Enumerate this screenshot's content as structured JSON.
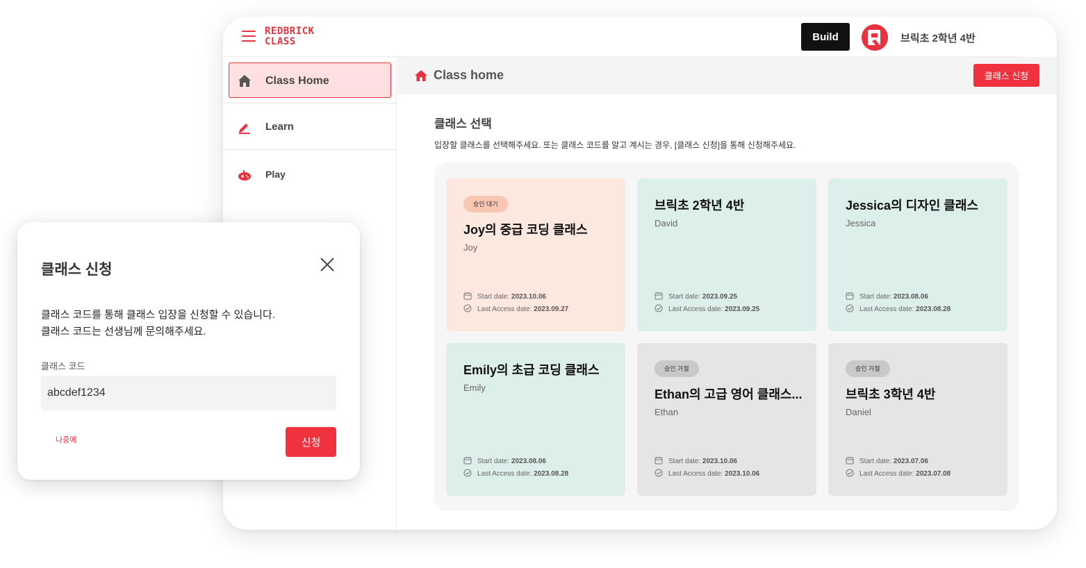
{
  "brand": {
    "logo_line1": "REDBRICK",
    "logo_line2": "CLASS",
    "accent_color": "#e8323e"
  },
  "topbar": {
    "build_label": "Build",
    "user_name": "브릭초 2학년 4반"
  },
  "sidebar": {
    "items": [
      {
        "label": "Class Home",
        "icon": "house-icon",
        "active": true
      },
      {
        "label": "Learn",
        "icon": "pencil-icon",
        "active": false
      },
      {
        "label": "Play",
        "icon": "gamepad-icon",
        "active": false
      }
    ]
  },
  "content": {
    "header_title": "Class home",
    "apply_button": "클래스 신청",
    "section_title": "클래스 선택",
    "section_desc": "입장할 클래스를 선택해주세요. 또는 클래스 코드를 알고 계시는 경우, [클래스 신청]을 통해 신청해주세요.",
    "start_label": "Start date: ",
    "access_label": "Last Access date: ",
    "cards": [
      {
        "badge": "승인 대기",
        "title": "Joy의 중급 코딩 클래스",
        "teacher": "Joy",
        "start": "2023.10.06",
        "last_access": "2023.09.27",
        "status": "pending"
      },
      {
        "badge": "",
        "title": "브릭초 2학년 4반",
        "teacher": "David",
        "start": "2023.09.25",
        "last_access": "2023.09.25",
        "status": "active"
      },
      {
        "badge": "",
        "title": "Jessica의 디자인 클래스",
        "teacher": "Jessica",
        "start": "2023.08.06",
        "last_access": "2023.08.28",
        "status": "active"
      },
      {
        "badge": "",
        "title": "Emily의 초급 코딩 클래스",
        "teacher": "Emily",
        "start": "2023.08.06",
        "last_access": "2023.08.28",
        "status": "active"
      },
      {
        "badge": "승인 거절",
        "title": "Ethan의 고급 영어 클래스...",
        "teacher": "Ethan",
        "start": "2023.10.06",
        "last_access": "2023.10.06",
        "status": "rejected"
      },
      {
        "badge": "승인 거절",
        "title": "브릭초 3학년 4반",
        "teacher": "Daniel",
        "start": "2023.07.06",
        "last_access": "2023.07.08",
        "status": "rejected"
      }
    ]
  },
  "modal": {
    "title": "클래스 신청",
    "desc_line1": "클래스 코드를 통해 클래스 입장을 신청할 수 있습니다.",
    "desc_line2": "클래스 코드는 선생님께 문의해주세요.",
    "field_label": "클래스 코드",
    "code_value": "abcdef1234",
    "later_label": "나중에",
    "submit_label": "신청"
  }
}
